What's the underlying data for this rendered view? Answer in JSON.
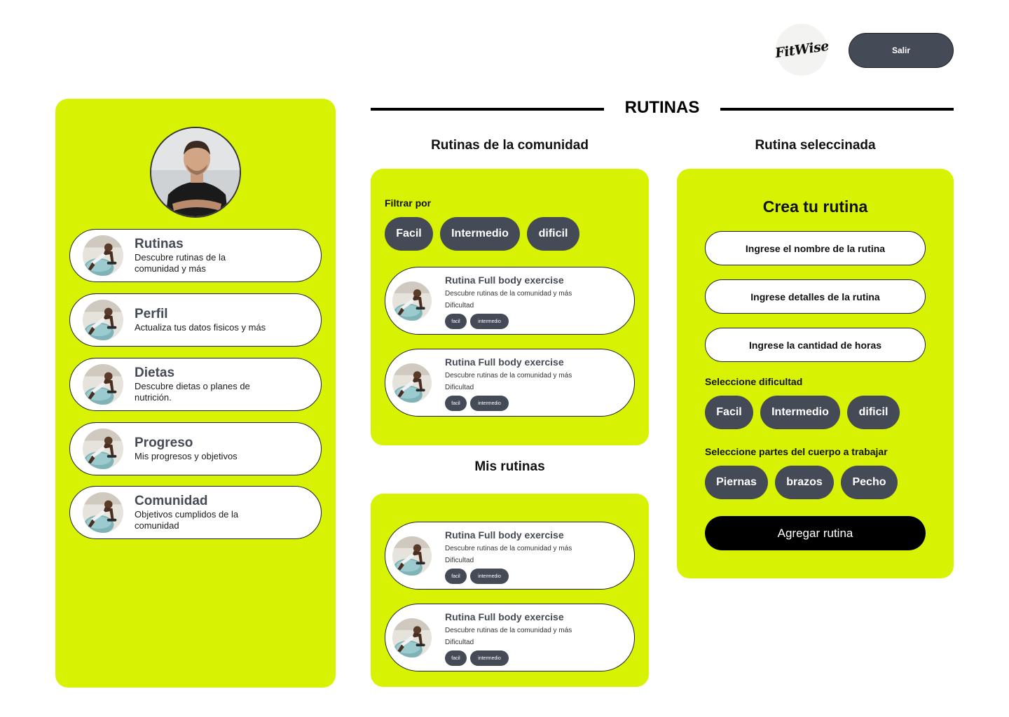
{
  "header": {
    "logo_text": "FitWise",
    "exit_label": "Salir"
  },
  "page_title": "RUTINAS",
  "sidebar": {
    "items": [
      {
        "title": "Rutinas",
        "desc": "Descubre rutinas de la comunidad y más"
      },
      {
        "title": "Perfil",
        "desc": "Actualiza tus datos fisicos y más"
      },
      {
        "title": "Dietas",
        "desc": "Descubre dietas o planes de nutrición."
      },
      {
        "title": "Progreso",
        "desc": "Mis progresos y objetivos"
      },
      {
        "title": "Comunidad",
        "desc": "Objetivos cumplidos de la comunidad"
      }
    ]
  },
  "community": {
    "title": "Rutinas de la comunidad",
    "filter_label": "Filtrar por",
    "filters": [
      "Facil",
      "Intermedio",
      "dificil"
    ],
    "cards": [
      {
        "title": "Rutina Full body exercise",
        "desc": "Descubre rutinas de la comunidad y más",
        "difficulty_label": "Dificultad",
        "tags": [
          "facil",
          "intermedio"
        ]
      },
      {
        "title": "Rutina Full body exercise",
        "desc": "Descubre rutinas de la comunidad y más",
        "difficulty_label": "Dificultad",
        "tags": [
          "facil",
          "intermedio"
        ]
      }
    ]
  },
  "mine": {
    "title": "Mis rutinas",
    "cards": [
      {
        "title": "Rutina Full body exercise",
        "desc": "Descubre rutinas de la comunidad y más",
        "difficulty_label": "Dificultad",
        "tags": [
          "facil",
          "intermedio"
        ]
      },
      {
        "title": "Rutina Full body exercise",
        "desc": "Descubre rutinas de la comunidad y más",
        "difficulty_label": "Dificultad",
        "tags": [
          "facil",
          "intermedio"
        ]
      }
    ]
  },
  "selected": {
    "title": "Rutina seleccinada",
    "form_title": "Crea tu rutina",
    "name_placeholder": "Ingrese el nombre de la rutina",
    "details_placeholder": "Ingrese detalles de la rutina",
    "hours_placeholder": "Ingrese la cantidad de horas",
    "difficulty_label": "Seleccione dificultad",
    "difficulties": [
      "Facil",
      "Intermedio",
      "dificil"
    ],
    "body_label": "Seleccione partes del cuerpo a trabajar",
    "body_parts": [
      "Piernas",
      "brazos",
      "Pecho"
    ],
    "submit_label": "Agregar rutina"
  },
  "colors": {
    "accent": "#d7f303",
    "chip": "#454a57",
    "dark": "#000000"
  }
}
